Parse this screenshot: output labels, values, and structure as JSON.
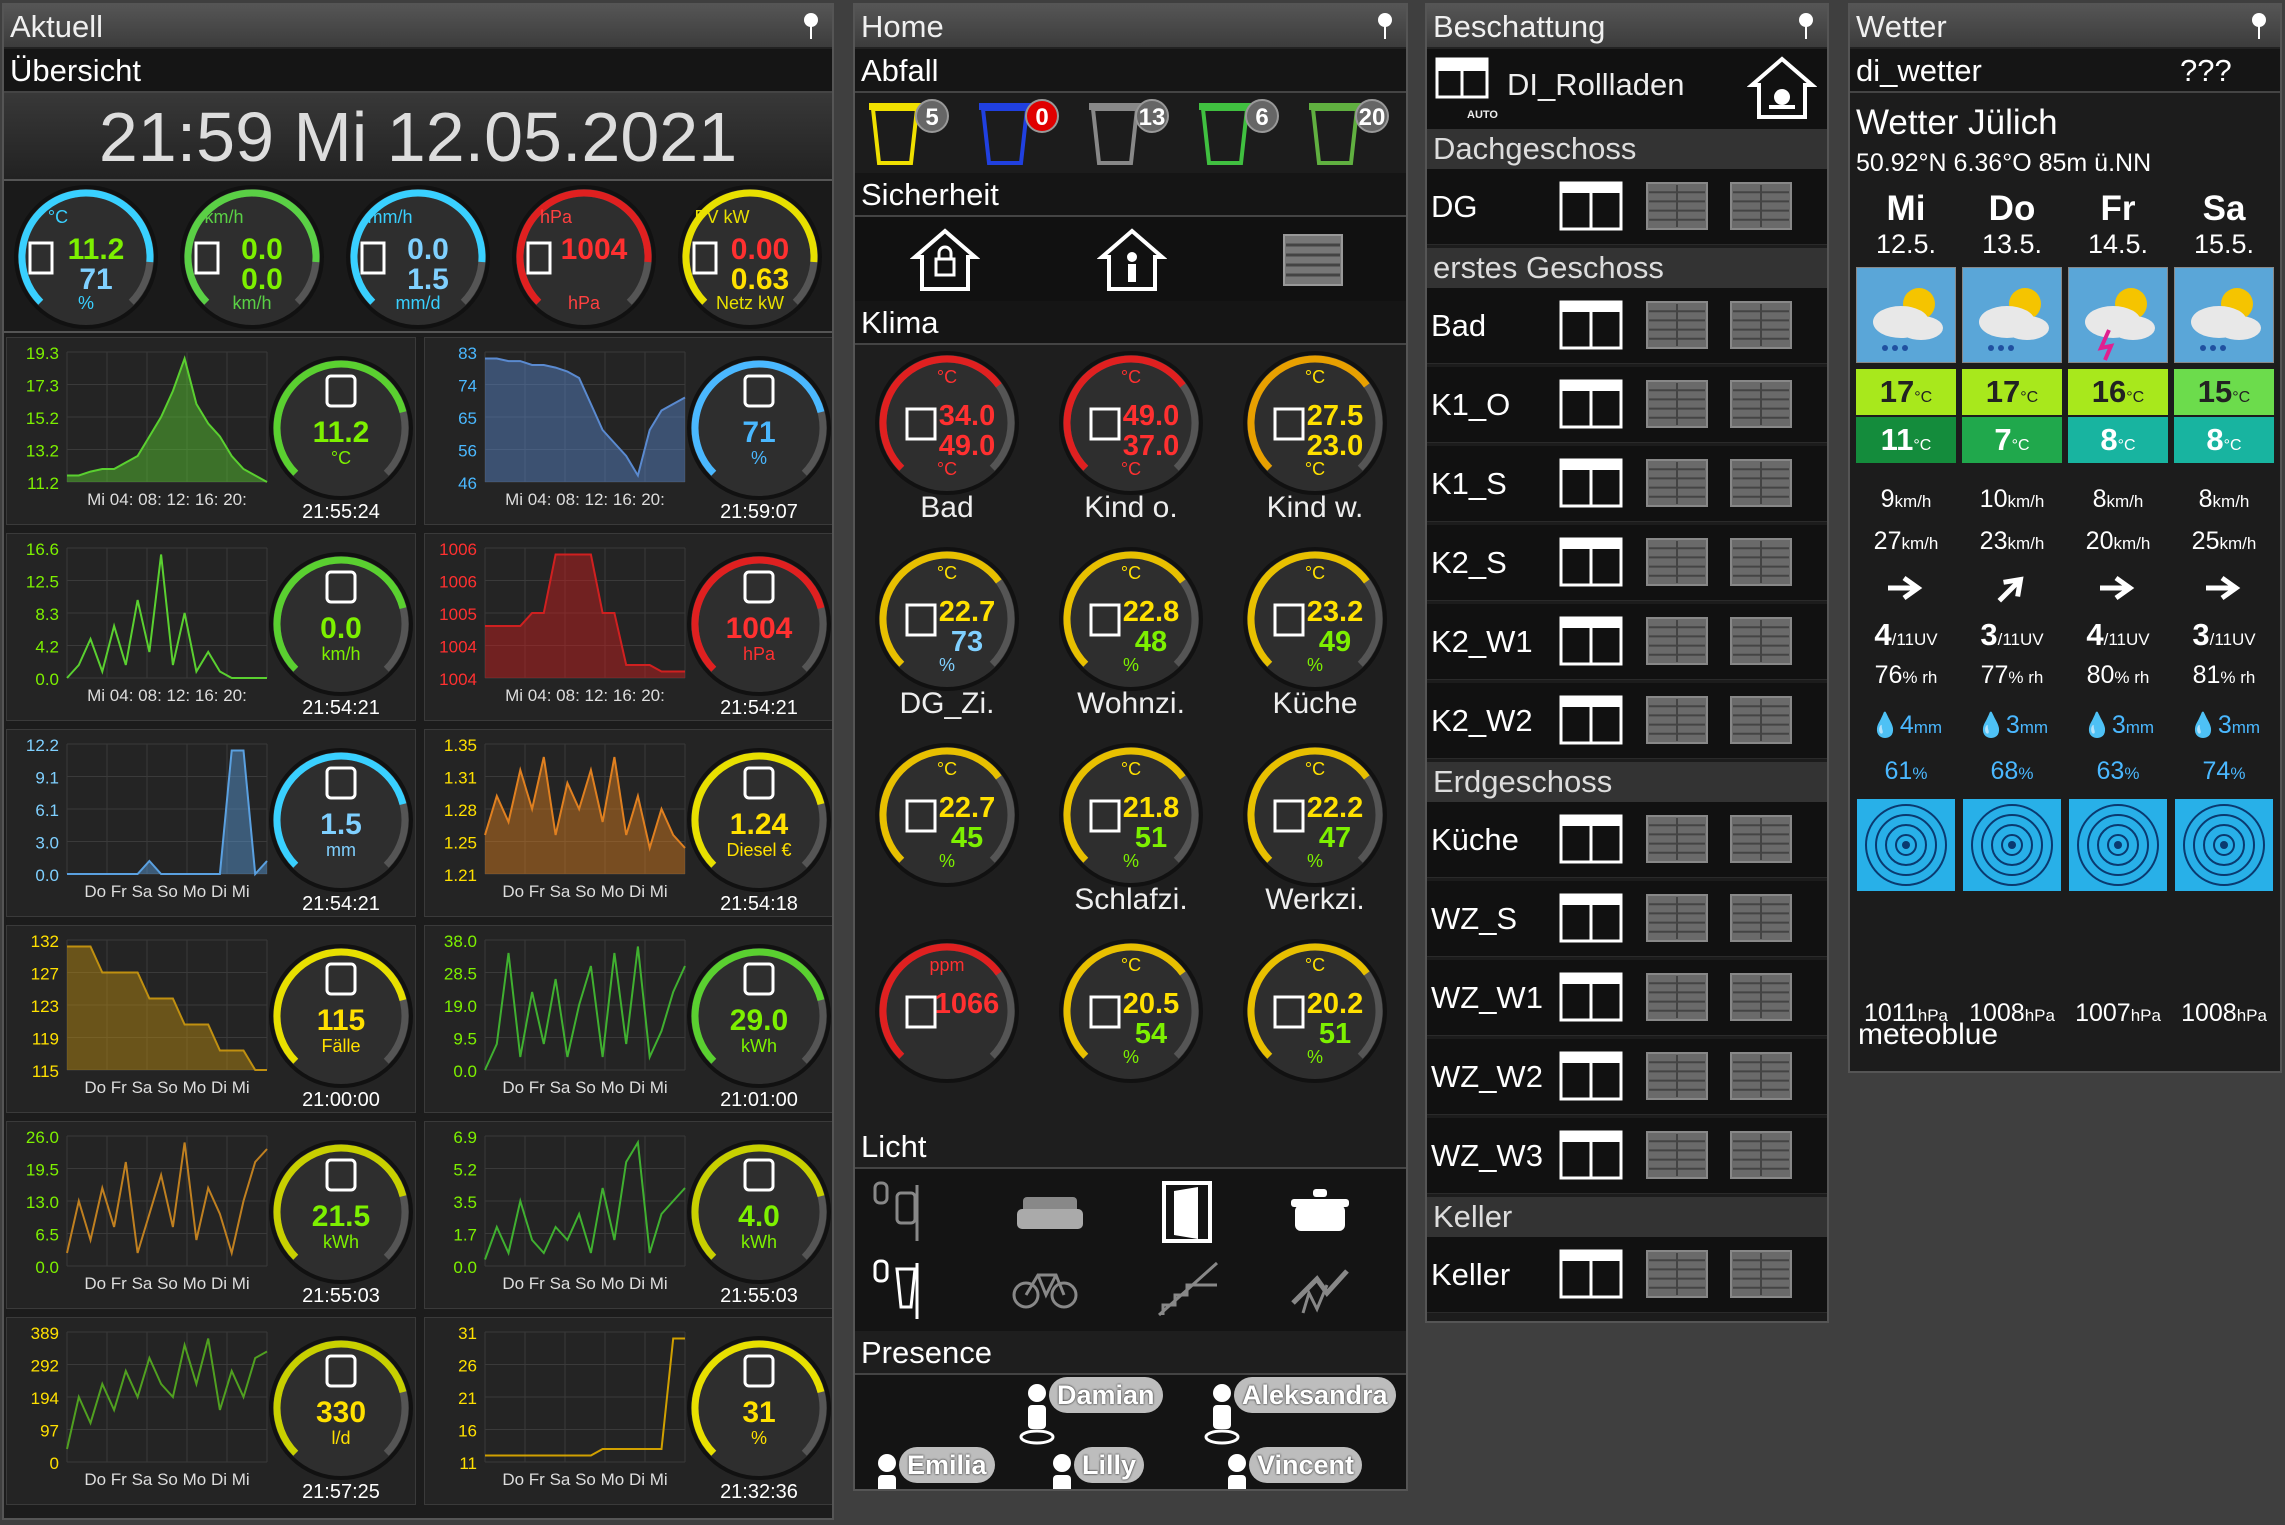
{
  "aktuell": {
    "title": "Aktuell",
    "subtitle": "Übersicht",
    "clock": "21:59  Mi 12.05.2021",
    "gauges": [
      {
        "unit_top": "°C",
        "v1": "11.2",
        "v2": "71",
        "unit_bot": "%",
        "color": "#39d0ff",
        "v1c": "#7df000",
        "v2c": "#7fd0ff",
        "icon": "thermo-hygro-icon"
      },
      {
        "unit_top": "km/h",
        "v1": "0.0",
        "v2": "0.0",
        "unit_bot": "km/h",
        "color": "#5ad045",
        "v1c": "#7df000",
        "v2c": "#7df000",
        "icon": "windsock-icon"
      },
      {
        "unit_top": "mm/h",
        "v1": "0.0",
        "v2": "1.5",
        "unit_bot": "mm/d",
        "color": "#39d0ff",
        "v1c": "#7fd0ff",
        "v2c": "#7fd0ff",
        "icon": "rain-gauge-icon"
      },
      {
        "unit_top": "hPa",
        "v1": "1004",
        "v2": "",
        "unit_bot": "hPa",
        "color": "#e02020",
        "v1c": "#ff3030",
        "v2c": "#ff3030",
        "icon": "barometer-icon"
      },
      {
        "unit_top": "PV kW",
        "v1": "0.00",
        "v2": "0.63",
        "unit_bot": "Netz kW",
        "color": "#e8e000",
        "v1c": "#ff3030",
        "v2c": "#ffe000",
        "icon": "lightning-icon"
      }
    ],
    "charts": [
      {
        "ylabels": [
          "19.3",
          "17.3",
          "15.2",
          "13.2",
          "11.2"
        ],
        "xlabel": "Mi 04: 08: 12: 16: 20:",
        "value": "11.2",
        "unit": "°C",
        "time": "21:55:24",
        "color": "#5ad030",
        "vcolor": "#7df000",
        "icon": "thermometer-icon",
        "fill": true,
        "pts": [
          0.05,
          0.05,
          0.08,
          0.1,
          0.1,
          0.15,
          0.2,
          0.35,
          0.5,
          0.7,
          0.95,
          0.6,
          0.45,
          0.35,
          0.2,
          0.1,
          0.05,
          0.0
        ],
        "ring": "#5ad030"
      },
      {
        "ylabels": [
          "83",
          "74",
          "65",
          "56",
          "46"
        ],
        "xlabel": "Mi 04: 08: 12: 16: 20:",
        "value": "71",
        "unit": "%",
        "time": "21:59:07",
        "color": "#5a8ad0",
        "vcolor": "#4ab8ff",
        "icon": "hygrometer-icon",
        "fill": true,
        "pts": [
          0.95,
          0.95,
          0.93,
          0.93,
          0.9,
          0.9,
          0.88,
          0.85,
          0.8,
          0.6,
          0.4,
          0.3,
          0.2,
          0.05,
          0.4,
          0.55,
          0.6,
          0.65
        ],
        "ring": "#4ab8ff"
      },
      {
        "ylabels": [
          "16.6",
          "12.5",
          "8.3",
          "4.2",
          "0.0"
        ],
        "xlabel": "Mi 04: 08: 12: 16: 20:",
        "value": "0.0",
        "unit": "km/h",
        "time": "21:54:21",
        "color": "#5ad030",
        "vcolor": "#7df000",
        "icon": "windsock-icon",
        "fill": false,
        "pts": [
          0,
          0.1,
          0.3,
          0.05,
          0.4,
          0.1,
          0.6,
          0.2,
          0.95,
          0.1,
          0.5,
          0.05,
          0.2,
          0.05,
          0,
          0,
          0,
          0
        ],
        "ring": "#5ad030"
      },
      {
        "ylabels": [
          "1006",
          "1006",
          "1005",
          "1004",
          "1004"
        ],
        "xlabel": "Mi 04: 08: 12: 16: 20:",
        "value": "1004",
        "unit": "hPa",
        "time": "21:54:21",
        "color": "#d02020",
        "vcolor": "#ff3030",
        "icon": "barometer-icon",
        "fill": true,
        "pts": [
          0.4,
          0.4,
          0.4,
          0.4,
          0.5,
          0.5,
          0.95,
          0.95,
          0.95,
          0.95,
          0.5,
          0.5,
          0.1,
          0.1,
          0.1,
          0.05,
          0.05,
          0.05
        ],
        "ring": "#e02020"
      },
      {
        "ylabels": [
          "12.2",
          "9.1",
          "6.1",
          "3.0",
          "0.0"
        ],
        "xlabel": "Do Fr Sa So Mo Di Mi",
        "value": "1.5",
        "unit": "mm",
        "time": "21:54:21",
        "color": "#5aa0e0",
        "vcolor": "#7fd0ff",
        "icon": "rain-gauge-icon",
        "fill": true,
        "pts": [
          0,
          0,
          0,
          0,
          0,
          0,
          0,
          0.1,
          0,
          0,
          0,
          0,
          0,
          0,
          0.95,
          0.95,
          0,
          0.1
        ],
        "ring": "#39d0ff"
      },
      {
        "ylabels": [
          "1.35",
          "1.31",
          "1.28",
          "1.25",
          "1.21"
        ],
        "xlabel": "Do Fr Sa So Mo Di Mi",
        "value": "1.24",
        "unit": "Diesel €",
        "time": "21:54:18",
        "color": "#e08020",
        "vcolor": "#ffe000",
        "icon": "fuel-pump-icon",
        "fill": true,
        "pts": [
          0.3,
          0.6,
          0.4,
          0.8,
          0.5,
          0.9,
          0.3,
          0.7,
          0.5,
          0.8,
          0.4,
          0.9,
          0.3,
          0.6,
          0.2,
          0.5,
          0.3,
          0.2
        ],
        "ring": "#e8e000"
      },
      {
        "ylabels": [
          "132",
          "127",
          "123",
          "119",
          "115"
        ],
        "xlabel": "Do Fr Sa So Mo Di Mi",
        "value": "115",
        "unit": "Fälle",
        "time": "21:00:00",
        "color": "#c09010",
        "vcolor": "#ffe000",
        "icon": "virus-icon",
        "fill": true,
        "pts": [
          0.95,
          0.95,
          0.95,
          0.75,
          0.75,
          0.75,
          0.75,
          0.55,
          0.55,
          0.55,
          0.35,
          0.35,
          0.35,
          0.15,
          0.15,
          0.15,
          0.0,
          0.0
        ],
        "ring": "#e8e000"
      },
      {
        "ylabels": [
          "38.0",
          "28.5",
          "19.0",
          "9.5",
          "0.0"
        ],
        "xlabel": "Do Fr Sa So Mo Di Mi",
        "value": "29.0",
        "unit": "kWh",
        "time": "21:01:00",
        "color": "#40b030",
        "vcolor": "#7df000",
        "icon": "meter-icon",
        "fill": false,
        "pts": [
          0,
          0.2,
          0.9,
          0.1,
          0.6,
          0.2,
          0.7,
          0.1,
          0.5,
          0.8,
          0.1,
          0.9,
          0.2,
          0.95,
          0.1,
          0.3,
          0.6,
          0.8
        ],
        "ring": "#5ad030"
      },
      {
        "ylabels": [
          "26.0",
          "19.5",
          "13.0",
          "6.5",
          "0.0"
        ],
        "xlabel": "Do Fr Sa So Mo Di Mi",
        "value": "21.5",
        "unit": "kWh",
        "time": "21:55:03",
        "color": "#c08020",
        "vcolor": "#7df000",
        "icon": "solar-panel-icon",
        "fill": false,
        "pts": [
          0.1,
          0.5,
          0.2,
          0.6,
          0.3,
          0.8,
          0.1,
          0.4,
          0.7,
          0.3,
          0.95,
          0.2,
          0.6,
          0.4,
          0.1,
          0.5,
          0.8,
          0.9
        ],
        "ring": "#c8d000"
      },
      {
        "ylabels": [
          "6.9",
          "5.2",
          "3.5",
          "1.7",
          "0.0"
        ],
        "xlabel": "Do Fr Sa So Mo Di Mi",
        "value": "4.0",
        "unit": "kWh",
        "time": "21:55:03",
        "color": "#40b030",
        "vcolor": "#7df000",
        "icon": "lightning-icon",
        "fill": false,
        "pts": [
          0.05,
          0.3,
          0.1,
          0.5,
          0.2,
          0.1,
          0.3,
          0.2,
          0.4,
          0.1,
          0.6,
          0.2,
          0.8,
          0.95,
          0.1,
          0.4,
          0.5,
          0.6
        ],
        "ring": "#c8d000"
      },
      {
        "ylabels": [
          "389",
          "292",
          "194",
          "97",
          "0"
        ],
        "xlabel": "Do Fr Sa So Mo Di Mi",
        "value": "330",
        "unit": "l/d",
        "time": "21:57:25",
        "color": "#50a020",
        "vcolor": "#ffe000",
        "icon": "water-tap-icon",
        "fill": false,
        "pts": [
          0.1,
          0.5,
          0.3,
          0.6,
          0.4,
          0.7,
          0.5,
          0.8,
          0.6,
          0.5,
          0.9,
          0.6,
          0.95,
          0.4,
          0.7,
          0.5,
          0.8,
          0.85
        ],
        "ring": "#c8d000"
      },
      {
        "ylabels": [
          "31",
          "26",
          "21",
          "16",
          "11"
        ],
        "xlabel": "Do Fr Sa So Mo Di Mi",
        "value": "31",
        "unit": "%",
        "time": "21:32:36",
        "color": "#d0a000",
        "vcolor": "#ffe000",
        "icon": "tank-icon",
        "fill": false,
        "pts": [
          0.05,
          0.05,
          0.05,
          0.05,
          0.05,
          0.05,
          0.05,
          0.05,
          0.05,
          0.05,
          0.1,
          0.1,
          0.1,
          0.1,
          0.1,
          0.1,
          0.95,
          0.95
        ],
        "ring": "#e8e000"
      }
    ]
  },
  "home": {
    "title": "Home",
    "abfall": {
      "label": "Abfall",
      "bins": [
        {
          "n": "5",
          "color": "#f0e000"
        },
        {
          "n": "0",
          "color": "#2040e0"
        },
        {
          "n": "13",
          "color": "#888"
        },
        {
          "n": "6",
          "color": "#40c040"
        },
        {
          "n": "20",
          "color": "#60b040"
        }
      ]
    },
    "sicherheit": "Sicherheit",
    "klima": "Klima",
    "rooms": [
      {
        "name": "Bad",
        "v1": "34.0",
        "v2": "49.0",
        "u1": "°C",
        "u2": "°C",
        "color": "#e02020",
        "c1": "#ff3030",
        "c2": "#ff3030"
      },
      {
        "name": "Kind o.",
        "v1": "49.0",
        "v2": "37.0",
        "u1": "°C",
        "u2": "°C",
        "color": "#e02020",
        "c1": "#ff3030",
        "c2": "#ff3030"
      },
      {
        "name": "Kind w.",
        "v1": "27.5",
        "v2": "23.0",
        "u1": "°C",
        "u2": "°C",
        "color": "#e8a000",
        "c1": "#ffe000",
        "c2": "#ffe000"
      },
      {
        "name": "DG_Zi.",
        "v1": "22.7",
        "v2": "73",
        "u1": "°C",
        "u2": "%",
        "color": "#e8c000",
        "c1": "#ffe000",
        "c2": "#7fd0ff"
      },
      {
        "name": "Wohnzi.",
        "v1": "22.8",
        "v2": "48",
        "u1": "°C",
        "u2": "%",
        "color": "#e8c000",
        "c1": "#ffe000",
        "c2": "#7df000"
      },
      {
        "name": "Küche",
        "v1": "23.2",
        "v2": "49",
        "u1": "°C",
        "u2": "%",
        "color": "#e8c000",
        "c1": "#ffe000",
        "c2": "#7df000"
      },
      {
        "name": "Schlafzi.",
        "v1": "22.7",
        "v2": "45",
        "u1": "°C",
        "u2": "%",
        "color": "#e8c000",
        "c1": "#ffe000",
        "c2": "#7df000"
      },
      {
        "name": "Werkzi.",
        "v1": "21.8",
        "v2": "51",
        "u1": "°C",
        "u2": "%",
        "color": "#e8c000",
        "c1": "#ffe000",
        "c2": "#7df000"
      },
      {
        "name": "",
        "v1": "22.2",
        "v2": "47",
        "u1": "°C",
        "u2": "%",
        "color": "#e8c000",
        "c1": "#ffe000",
        "c2": "#7df000"
      },
      {
        "name": "",
        "v1": "1066",
        "v2": "",
        "u1": "ppm",
        "u2": "",
        "color": "#e02020",
        "c1": "#ff3030",
        "c2": "#ff3030"
      },
      {
        "name": "",
        "v1": "20.5",
        "v2": "54",
        "u1": "°C",
        "u2": "%",
        "color": "#e8c000",
        "c1": "#ffe000",
        "c2": "#7df000"
      },
      {
        "name": "",
        "v1": "20.2",
        "v2": "51",
        "u1": "°C",
        "u2": "%",
        "color": "#e8c000",
        "c1": "#ffe000",
        "c2": "#7df000"
      }
    ],
    "licht": "Licht",
    "presence": "Presence",
    "people": [
      "Damian",
      "Aleksandra",
      "Emilia",
      "Lilly",
      "Vincent"
    ]
  },
  "beschattung": {
    "title": "Beschattung",
    "device": "DI_Rollladen",
    "auto": "AUTO",
    "groups": [
      {
        "name": "Dachgeschoss",
        "rows": [
          "DG"
        ]
      },
      {
        "name": "erstes Geschoss",
        "rows": [
          "Bad",
          "K1_O",
          "K1_S",
          "K2_S",
          "K2_W1",
          "K2_W2"
        ]
      },
      {
        "name": "Erdgeschoss",
        "rows": [
          "Küche",
          "WZ_S",
          "WZ_W1",
          "WZ_W2",
          "WZ_W3"
        ]
      },
      {
        "name": "Keller",
        "rows": [
          "Keller"
        ]
      }
    ]
  },
  "wetter": {
    "title": "Wetter",
    "source": "di_wetter",
    "status": "???",
    "place": "Wetter Jülich",
    "coords": "50.92°N 6.36°O 85m ü.NN",
    "footer": "meteoblue",
    "days": [
      {
        "d": "Mi",
        "date": "12.5.",
        "tmax": "17",
        "tmin": "11",
        "cmax": "#a8e81c",
        "cmin": "#148c3c",
        "wind": "9",
        "gust": "27",
        "dir": 0,
        "uv": "4",
        "rh": "76",
        "rain": "4",
        "prob": "61",
        "hpa": "1011",
        "storm": false
      },
      {
        "d": "Do",
        "date": "13.5.",
        "tmax": "17",
        "tmin": "7",
        "cmax": "#a8e81c",
        "cmin": "#20a84c",
        "wind": "10",
        "gust": "23",
        "dir": -45,
        "uv": "3",
        "rh": "77",
        "rain": "3",
        "prob": "68",
        "hpa": "1008",
        "storm": false
      },
      {
        "d": "Fr",
        "date": "14.5.",
        "tmax": "16",
        "tmin": "8",
        "cmax": "#a8e81c",
        "cmin": "#18b4a0",
        "wind": "8",
        "gust": "20",
        "dir": 0,
        "uv": "4",
        "rh": "80",
        "rain": "3",
        "prob": "63",
        "hpa": "1007",
        "storm": true
      },
      {
        "d": "Sa",
        "date": "15.5.",
        "tmax": "15",
        "tmin": "8",
        "cmax": "#6cdc4c",
        "cmin": "#18b4a0",
        "wind": "8",
        "gust": "25",
        "dir": 0,
        "uv": "3",
        "rh": "81",
        "rain": "3",
        "prob": "74",
        "hpa": "1008",
        "storm": false
      }
    ],
    "units": {
      "temp": "°C",
      "wind": "km/h",
      "uv": "/11UV",
      "rh": "% rh",
      "rain": "mm",
      "prob": "%",
      "hpa": "hPa"
    }
  }
}
